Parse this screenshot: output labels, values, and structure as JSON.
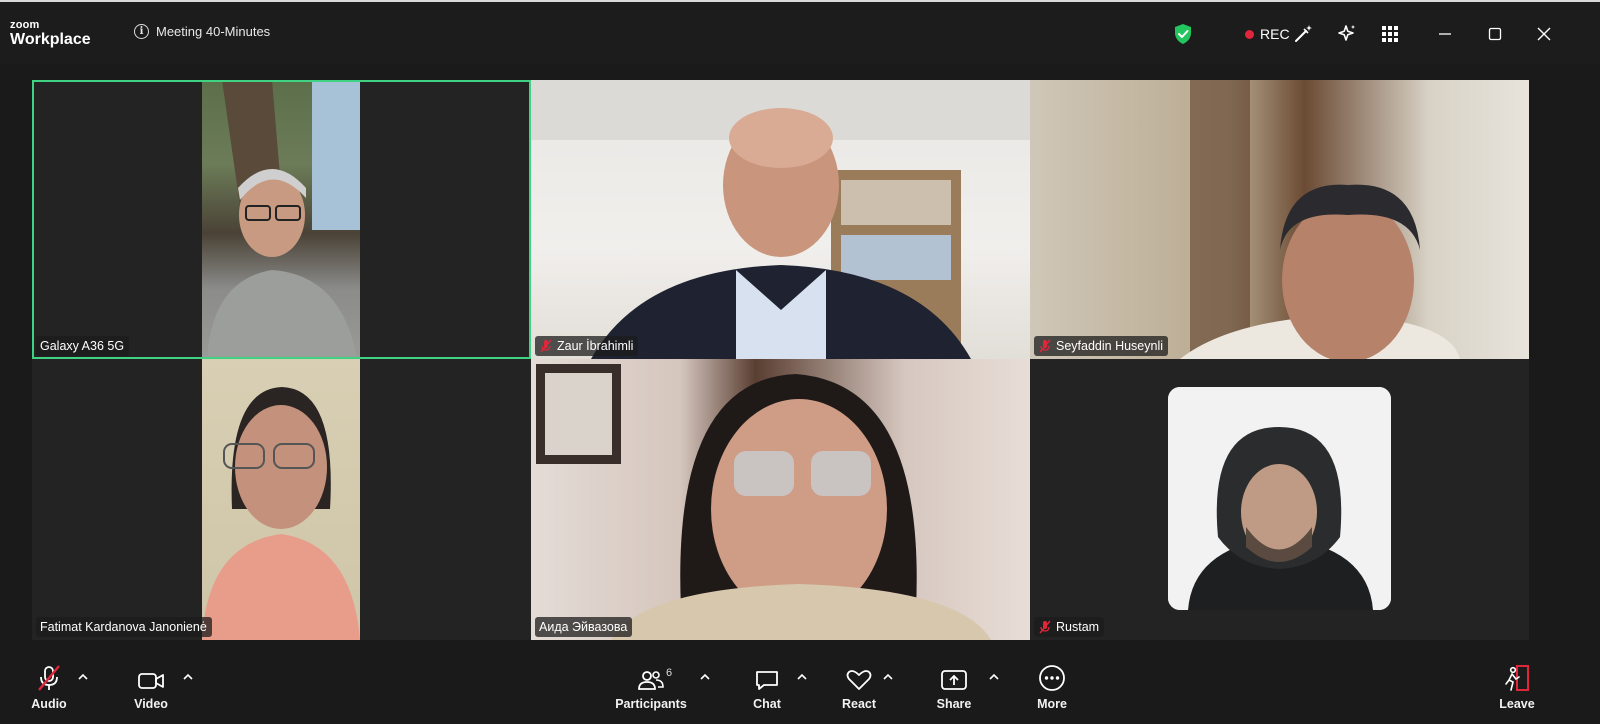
{
  "app": {
    "logo_top": "zoom",
    "logo_bottom": "Workplace"
  },
  "meeting": {
    "title": "Meeting 40-Minutes",
    "recording_label": "REC"
  },
  "colors": {
    "accent_green": "#3fd283",
    "rec_red": "#e0263b",
    "shield_green": "#22c55e",
    "leave_red": "#e0263b"
  },
  "titlebar_icons": [
    "shield-check-icon",
    "rec-indicator",
    "magic-wand-icon",
    "ai-sparkle-icon",
    "apps-grid-icon",
    "minimize-icon",
    "maximize-icon",
    "close-icon"
  ],
  "participants": [
    {
      "name": "Galaxy A36 5G",
      "muted": false,
      "active_speaker": true
    },
    {
      "name": "Zaur İbrahimli",
      "muted": true,
      "active_speaker": false
    },
    {
      "name": "Seyfaddin Huseynli",
      "muted": true,
      "active_speaker": false
    },
    {
      "name": "Fatimat Kardanova Janonienė",
      "muted": false,
      "active_speaker": false
    },
    {
      "name": "Аида Эйвазова",
      "muted": false,
      "active_speaker": false
    },
    {
      "name": "Rustam",
      "muted": true,
      "active_speaker": false
    }
  ],
  "toolbar": {
    "audio": {
      "label": "Audio",
      "icon": "mic-muted-icon"
    },
    "video": {
      "label": "Video",
      "icon": "video-camera-icon"
    },
    "participants": {
      "label": "Participants",
      "count": "6",
      "icon": "people-icon"
    },
    "chat": {
      "label": "Chat",
      "icon": "chat-bubble-icon"
    },
    "react": {
      "label": "React",
      "icon": "heart-icon"
    },
    "share": {
      "label": "Share",
      "icon": "share-screen-icon"
    },
    "more": {
      "label": "More",
      "icon": "more-dots-icon"
    },
    "leave": {
      "label": "Leave",
      "icon": "leave-door-icon"
    }
  }
}
